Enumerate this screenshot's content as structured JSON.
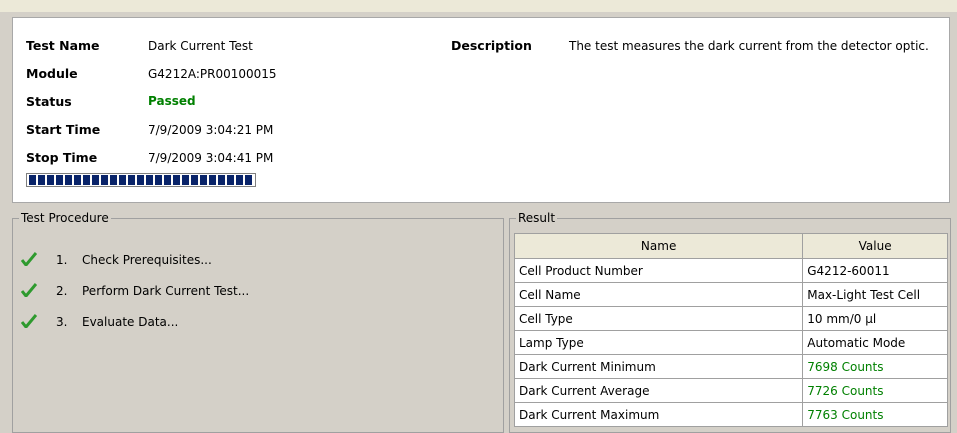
{
  "info": {
    "test_name_label": "Test Name",
    "test_name": "Dark Current Test",
    "module_label": "Module",
    "module": "G4212A:PR00100015",
    "status_label": "Status",
    "status": "Passed",
    "start_label": "Start Time",
    "start_time": "7/9/2009 3:04:21 PM",
    "stop_label": "Stop Time",
    "stop_time": "7/9/2009 3:04:41 PM",
    "description_label": "Description",
    "description": "The test measures the dark current from the detector optic.",
    "progress": 1.0
  },
  "procedure": {
    "title": "Test Procedure",
    "steps": [
      {
        "num": "1.",
        "label": "Check Prerequisites...",
        "icon": "check-icon"
      },
      {
        "num": "2.",
        "label": "Perform Dark Current Test...",
        "icon": "check-icon"
      },
      {
        "num": "3.",
        "label": "Evaluate Data...",
        "icon": "check-icon"
      }
    ]
  },
  "result": {
    "title": "Result",
    "headers": [
      "Name",
      "Value"
    ],
    "rows": [
      {
        "name": "Cell Product Number",
        "value": "G4212-60011"
      },
      {
        "name": "Cell Name",
        "value": "Max-Light Test Cell"
      },
      {
        "name": "Cell Type",
        "value": "10 mm/0 µl"
      },
      {
        "name": "Lamp Type",
        "value": "Automatic Mode"
      },
      {
        "name": "Dark Current Minimum",
        "value": "7698 Counts"
      },
      {
        "name": "Dark Current Average",
        "value": "7726 Counts"
      },
      {
        "name": "Dark Current Maximum",
        "value": "7763 Counts"
      }
    ]
  },
  "colors": {
    "pass_green": "#008000",
    "progress_blue": "#0a246a",
    "check_green": "#2e9a2e"
  }
}
